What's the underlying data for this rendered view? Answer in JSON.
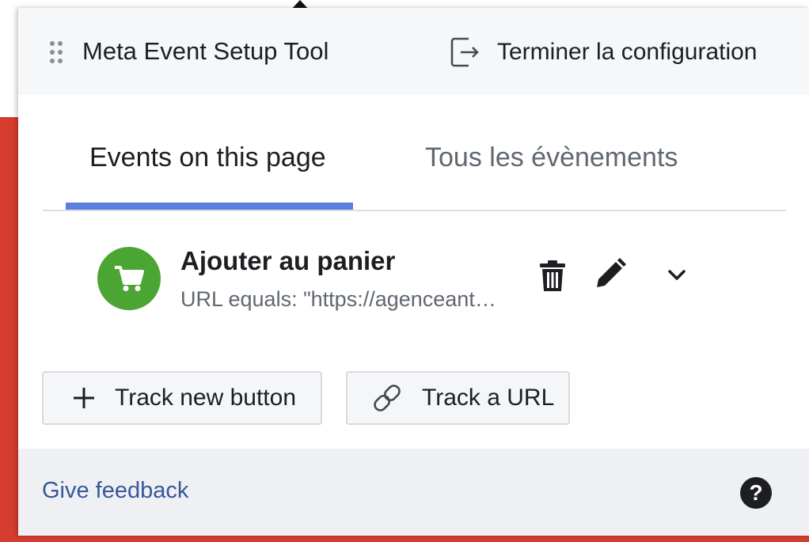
{
  "app": {
    "title": "Meta Event Setup Tool",
    "finish_label": "Terminer la configuration"
  },
  "tabs": [
    {
      "label": "Events on this page",
      "active": true
    },
    {
      "label": "Tous les évènements",
      "active": false
    }
  ],
  "event": {
    "icon": "shopping-cart-icon",
    "title": "Ajouter au panier",
    "subtitle": "URL equals: \"https://agenceant…"
  },
  "actions": {
    "track_button_label": "Track new button",
    "track_url_label": "Track a URL"
  },
  "footer": {
    "feedback_label": "Give feedback",
    "help_symbol": "?"
  },
  "colors": {
    "accent": "#5b7fe0",
    "event_green": "#4ba532",
    "link": "#385898",
    "page_background": "#d63d2e"
  }
}
